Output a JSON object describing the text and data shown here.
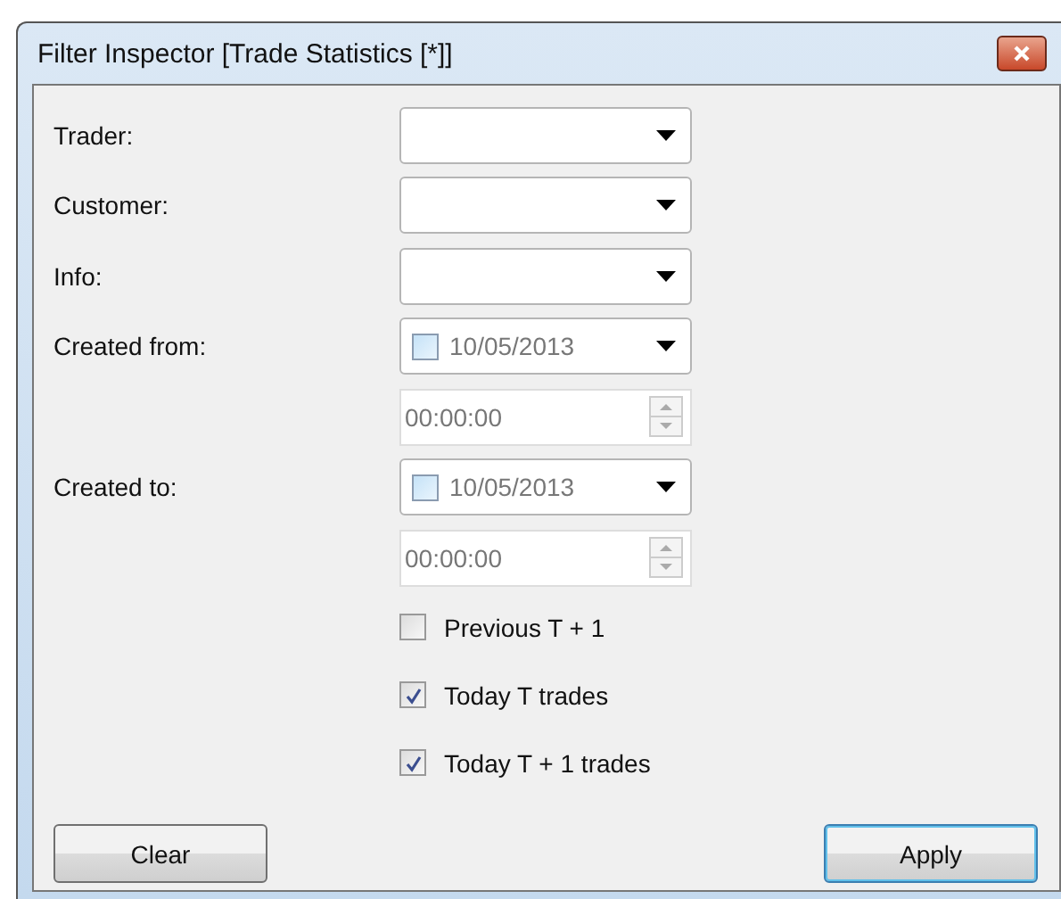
{
  "window": {
    "title": "Filter Inspector [Trade Statistics [*]]"
  },
  "fields": [
    {
      "label": "Trader:",
      "kind": "combo"
    },
    {
      "label": "Customer:",
      "kind": "combo"
    },
    {
      "label": "Info:",
      "kind": "combo"
    },
    {
      "label": "Created from:",
      "kind": "date",
      "checked": false,
      "value": "10/05/2013"
    },
    {
      "kind": "time",
      "value": "00:00:00"
    },
    {
      "label": "Created to:",
      "kind": "date",
      "checked": false,
      "value": "10/05/2013"
    },
    {
      "kind": "time",
      "value": "00:00:00"
    }
  ],
  "options": [
    {
      "label": "Previous T + 1",
      "checked": false
    },
    {
      "label": "Today T trades",
      "checked": true
    },
    {
      "label": "Today T + 1 trades",
      "checked": true
    }
  ],
  "buttons": [
    {
      "label": "Clear",
      "default": false
    },
    {
      "label": "Apply",
      "default": true
    }
  ]
}
